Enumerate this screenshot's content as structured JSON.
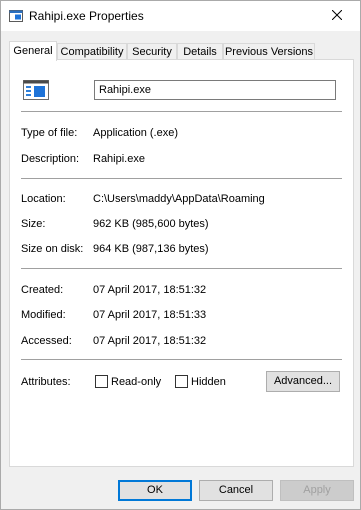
{
  "window": {
    "title": "Rahipi.exe Properties"
  },
  "tabs": [
    {
      "label": "General",
      "active": true
    },
    {
      "label": "Compatibility"
    },
    {
      "label": "Security"
    },
    {
      "label": "Details"
    },
    {
      "label": "Previous Versions"
    }
  ],
  "general": {
    "file_name": "Rahipi.exe",
    "type_label": "Type of file:",
    "type_value": "Application (.exe)",
    "description_label": "Description:",
    "description_value": "Rahipi.exe",
    "location_label": "Location:",
    "location_value": "C:\\Users\\maddy\\AppData\\Roaming",
    "size_label": "Size:",
    "size_value": "962 KB (985,600 bytes)",
    "size_on_disk_label": "Size on disk:",
    "size_on_disk_value": "964 KB (987,136 bytes)",
    "created_label": "Created:",
    "created_value": "07 April 2017, 18:51:32",
    "modified_label": "Modified:",
    "modified_value": "07 April 2017, 18:51:33",
    "accessed_label": "Accessed:",
    "accessed_value": "07 April 2017, 18:51:32",
    "attributes_label": "Attributes:",
    "readonly_label": "Read-only",
    "hidden_label": "Hidden",
    "advanced_label": "Advanced..."
  },
  "footer": {
    "ok_label": "OK",
    "cancel_label": "Cancel",
    "apply_label": "Apply"
  },
  "icons": {
    "title": "exe-window-icon",
    "close": "close-icon",
    "file": "application-file-icon"
  },
  "colors": {
    "accent": "#0078d7",
    "window_bg": "#f0f0f0",
    "panel_bg": "#ffffff"
  }
}
